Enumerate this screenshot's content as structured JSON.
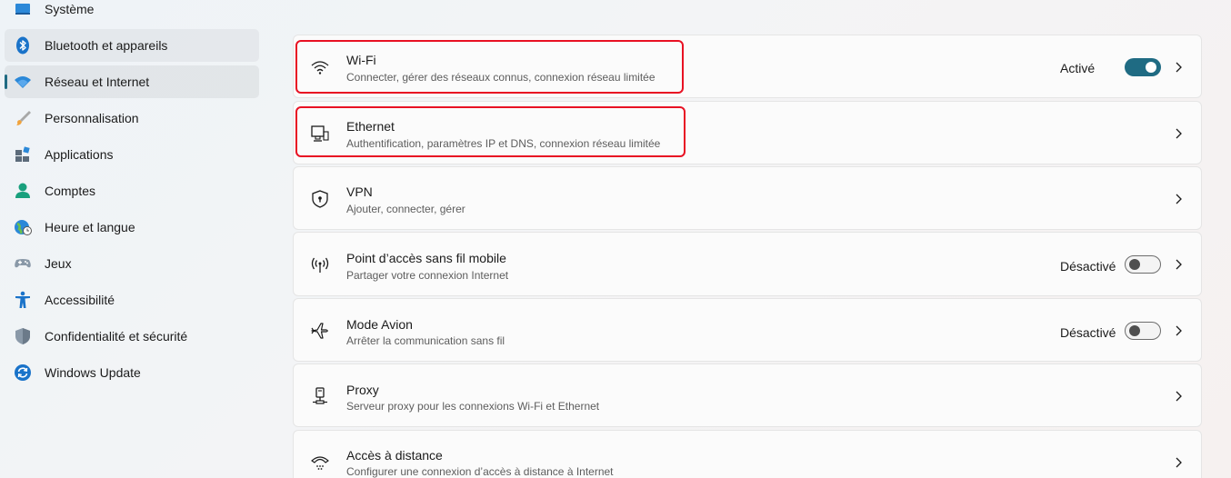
{
  "sidebar": {
    "items": [
      {
        "label": "Système",
        "icon": "display-icon"
      },
      {
        "label": "Bluetooth et appareils",
        "icon": "bluetooth-icon"
      },
      {
        "label": "Réseau et Internet",
        "icon": "wifi-icon"
      },
      {
        "label": "Personnalisation",
        "icon": "brush-icon"
      },
      {
        "label": "Applications",
        "icon": "apps-icon"
      },
      {
        "label": "Comptes",
        "icon": "person-icon"
      },
      {
        "label": "Heure et langue",
        "icon": "globe-clock-icon"
      },
      {
        "label": "Jeux",
        "icon": "gamepad-icon"
      },
      {
        "label": "Accessibilité",
        "icon": "accessibility-icon"
      },
      {
        "label": "Confidentialité et sécurité",
        "icon": "shield-icon"
      },
      {
        "label": "Windows Update",
        "icon": "update-icon"
      }
    ]
  },
  "cards": [
    {
      "title": "Wi-Fi",
      "subtitle": "Connecter, gérer des réseaux connus, connexion réseau limitée",
      "state": "Activé",
      "toggle": true
    },
    {
      "title": "Ethernet",
      "subtitle": "Authentification, paramètres IP et DNS, connexion réseau limitée"
    },
    {
      "title": "VPN",
      "subtitle": "Ajouter, connecter, gérer"
    },
    {
      "title": "Point d’accès sans fil mobile",
      "subtitle": "Partager votre connexion Internet",
      "state": "Désactivé",
      "toggle": false
    },
    {
      "title": "Mode Avion",
      "subtitle": "Arrêter la communication sans fil",
      "state": "Désactivé",
      "toggle": false
    },
    {
      "title": "Proxy",
      "subtitle": "Serveur proxy pour les connexions Wi-Fi et Ethernet"
    },
    {
      "title": "Accès à distance",
      "subtitle": "Configurer une connexion d’accès à distance à Internet"
    }
  ],
  "colors": {
    "accent": "#1f6b83",
    "highlight": "#e81123"
  }
}
